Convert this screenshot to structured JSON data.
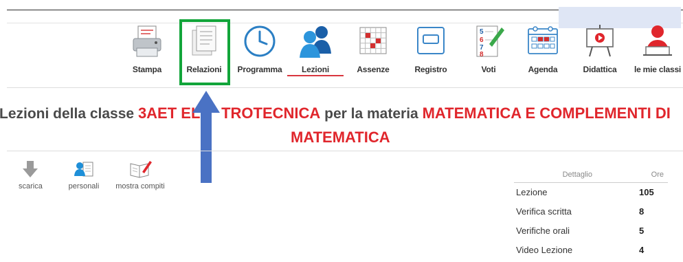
{
  "toolbar": {
    "items": [
      {
        "label": "Stampa",
        "icon": "printer-icon"
      },
      {
        "label": "Relazioni",
        "icon": "documents-icon"
      },
      {
        "label": "Programma",
        "icon": "clock-icon"
      },
      {
        "label": "Lezioni",
        "icon": "users-icon"
      },
      {
        "label": "Assenze",
        "icon": "grid-calendar-icon"
      },
      {
        "label": "Registro",
        "icon": "register-icon"
      },
      {
        "label": "Voti",
        "icon": "grades-icon"
      },
      {
        "label": "Agenda",
        "icon": "agenda-icon"
      },
      {
        "label": "Didattica",
        "icon": "board-play-icon"
      },
      {
        "label": "le mie classi",
        "icon": "teacher-icon"
      }
    ],
    "active": "Lezioni",
    "highlighted": "Relazioni"
  },
  "heading": {
    "prefix": "Lezioni della classe",
    "class_name": "3AET ELE",
    "class_name_rest": "TROTECNICA",
    "middle": "per la materia",
    "subject_line1": "MATEMATICA E COMPLEMENTI DI",
    "subject_line2": "MATEMATICA"
  },
  "actions": [
    {
      "label": "scarica",
      "icon": "download-icon"
    },
    {
      "label": "personali",
      "icon": "personal-icon"
    },
    {
      "label": "mostra compiti",
      "icon": "homework-icon"
    }
  ],
  "summary": {
    "col_detail": "Dettaglio",
    "col_hours": "Ore",
    "rows": [
      {
        "label": "Lezione",
        "value": "105"
      },
      {
        "label": "Verifica scritta",
        "value": "8"
      },
      {
        "label": "Verifiche orali",
        "value": "5"
      },
      {
        "label": "Video Lezione",
        "value": "4"
      }
    ]
  },
  "colors": {
    "accent_red": "#e0262c",
    "highlight_green": "#12a53a",
    "arrow_blue": "#4a72c4",
    "icon_blue": "#1e8fd8"
  }
}
